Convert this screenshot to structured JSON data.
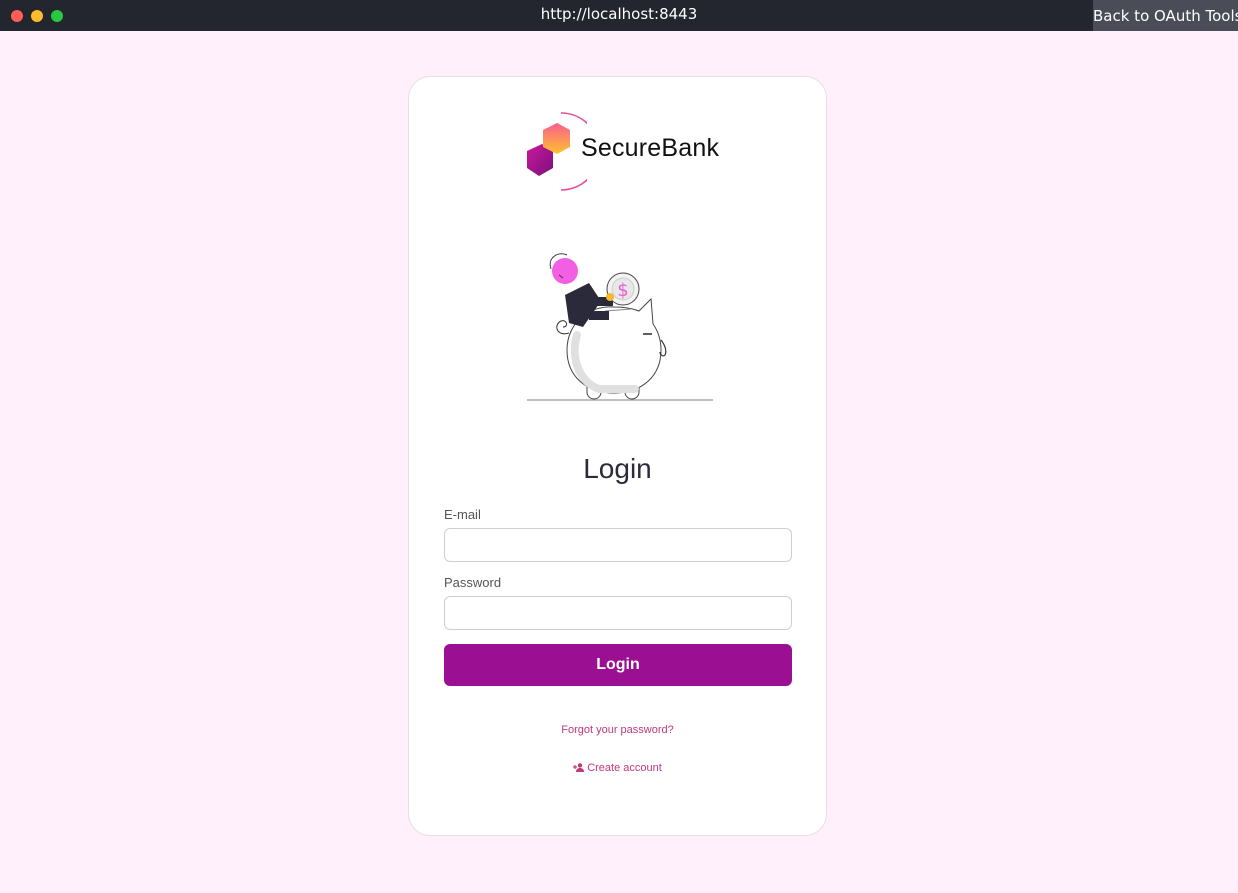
{
  "browser": {
    "url": "http://localhost:8443",
    "back_button": "Back to OAuth Tools"
  },
  "brand": {
    "name": "SecureBank",
    "primary_color": "#9b0f93",
    "accent_color": "#e0227f"
  },
  "login": {
    "title": "Login",
    "email_label": "E-mail",
    "email_value": "",
    "password_label": "Password",
    "password_value": "",
    "submit_label": "Login",
    "forgot_link": "Forgot your password?",
    "create_link": "Create account",
    "create_icon": "add-user-icon"
  }
}
